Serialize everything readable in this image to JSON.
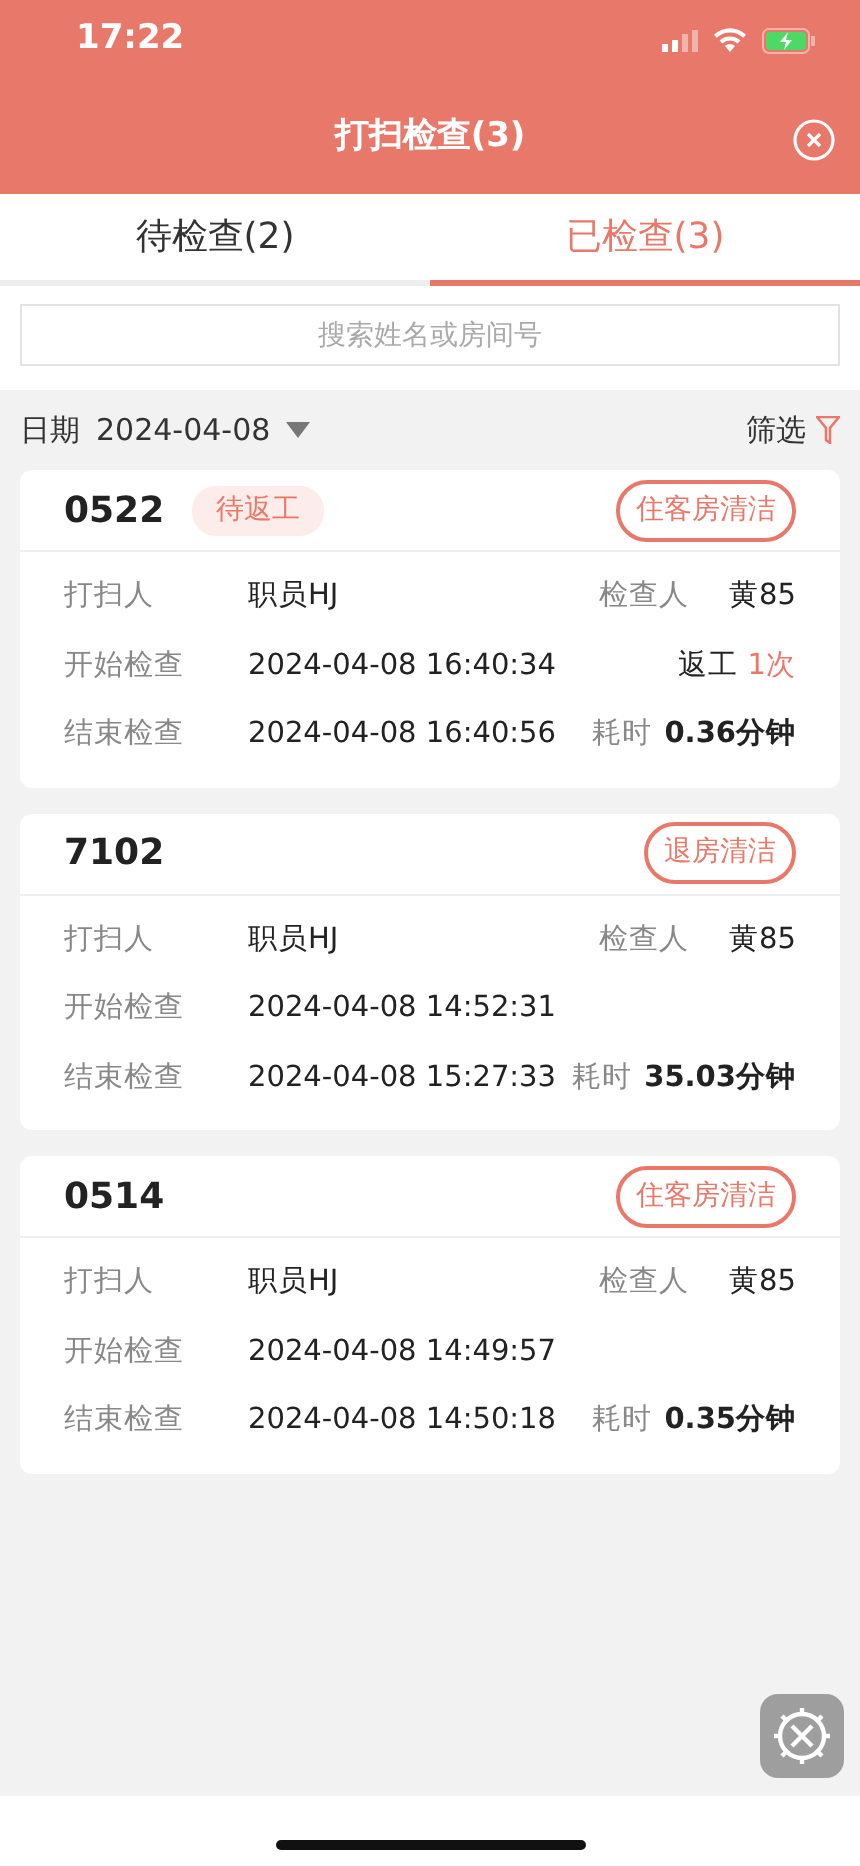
{
  "status_bar": {
    "time": "17:22"
  },
  "header": {
    "title": "打扫检查(3)"
  },
  "tabs": [
    {
      "label": "待检查(2)",
      "selected": false
    },
    {
      "label": "已检查(3)",
      "selected": true
    }
  ],
  "search": {
    "placeholder": "搜索姓名或房间号"
  },
  "date_filter": {
    "label": "日期",
    "value": "2024-04-08",
    "filter_label": "筛选"
  },
  "cards": [
    {
      "room": "0522",
      "status_tag": "待返工",
      "type": "住客房清洁",
      "cleaner_label": "打扫人",
      "cleaner": "职员HJ",
      "inspector_label": "检查人",
      "inspector": "黄85",
      "start_label": "开始检查",
      "start": "2024-04-08 16:40:34",
      "rework_label": "返工",
      "rework_count": "1次",
      "end_label": "结束检查",
      "end": "2024-04-08 16:40:56",
      "duration_label": "耗时",
      "duration": "0.36分钟"
    },
    {
      "room": "7102",
      "type": "退房清洁",
      "cleaner_label": "打扫人",
      "cleaner": "职员HJ",
      "inspector_label": "检查人",
      "inspector": "黄85",
      "start_label": "开始检查",
      "start": "2024-04-08 14:52:31",
      "end_label": "结束检查",
      "end": "2024-04-08 15:27:33",
      "duration_label": "耗时",
      "duration": "35.03分钟"
    },
    {
      "room": "0514",
      "type": "住客房清洁",
      "cleaner_label": "打扫人",
      "cleaner": "职员HJ",
      "inspector_label": "检查人",
      "inspector": "黄85",
      "start_label": "开始检查",
      "start": "2024-04-08 14:49:57",
      "end_label": "结束检查",
      "end": "2024-04-08 14:50:18",
      "duration_label": "耗时",
      "duration": "0.35分钟"
    }
  ]
}
